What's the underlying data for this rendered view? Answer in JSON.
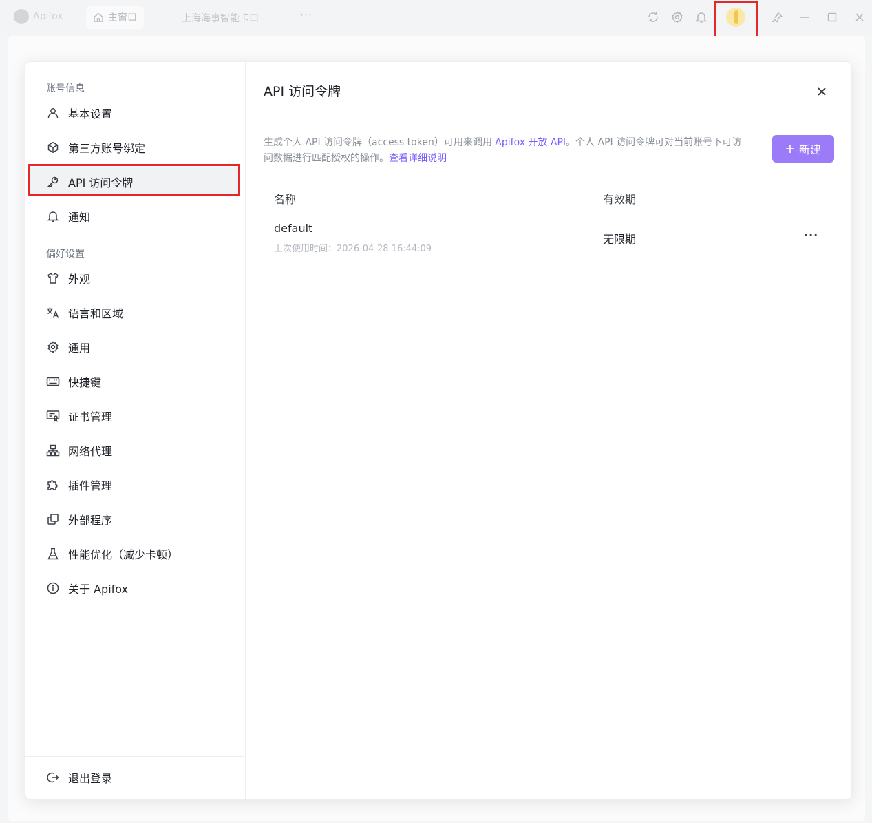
{
  "titlebar": {
    "app_name": "Apifox",
    "home_tab": "主窗口",
    "project_tab": "上海海事智能卡口",
    "more": "···",
    "icons": [
      "refresh-icon",
      "gear-icon",
      "bell-icon",
      "avatar",
      "pin-icon",
      "minimize-icon",
      "maximize-icon",
      "close-icon"
    ]
  },
  "sidebar": {
    "section_account": "账号信息",
    "section_prefs": "偏好设置",
    "items": [
      {
        "label": "基本设置",
        "icon": "user-icon"
      },
      {
        "label": "第三方账号绑定",
        "icon": "cube-icon"
      },
      {
        "label": "API 访问令牌",
        "icon": "key-icon",
        "active": true
      },
      {
        "label": "通知",
        "icon": "bell-icon"
      },
      {
        "label": "外观",
        "icon": "shirt-icon"
      },
      {
        "label": "语言和区域",
        "icon": "translate-icon"
      },
      {
        "label": "通用",
        "icon": "gear-icon"
      },
      {
        "label": "快捷键",
        "icon": "keyboard-icon"
      },
      {
        "label": "证书管理",
        "icon": "certificate-icon"
      },
      {
        "label": "网络代理",
        "icon": "network-icon"
      },
      {
        "label": "插件管理",
        "icon": "puzzle-icon"
      },
      {
        "label": "外部程序",
        "icon": "copy-icon"
      },
      {
        "label": "性能优化（减少卡顿）",
        "icon": "flask-icon"
      },
      {
        "label": "关于 Apifox",
        "icon": "info-icon"
      }
    ],
    "logout": "退出登录"
  },
  "main": {
    "title": "API 访问令牌",
    "desc_part1": "生成个人 API 访问令牌（access token）可用来调用 ",
    "desc_link1": "Apifox 开放 API",
    "desc_part2": "。个人 API 访问令牌可对当前账号下可访问数据进行匹配授权的操作。",
    "desc_link2": "查看详细说明",
    "new_button": "新建",
    "table": {
      "col_name": "名称",
      "col_expiry": "有效期",
      "rows": [
        {
          "name": "default",
          "last_used": "上次使用时间：2026-04-28 16:44:09",
          "expiry": "无限期"
        }
      ]
    }
  },
  "colors": {
    "accent": "#9b7bf7",
    "link": "#7c5cff",
    "highlight": "#e5262b"
  }
}
